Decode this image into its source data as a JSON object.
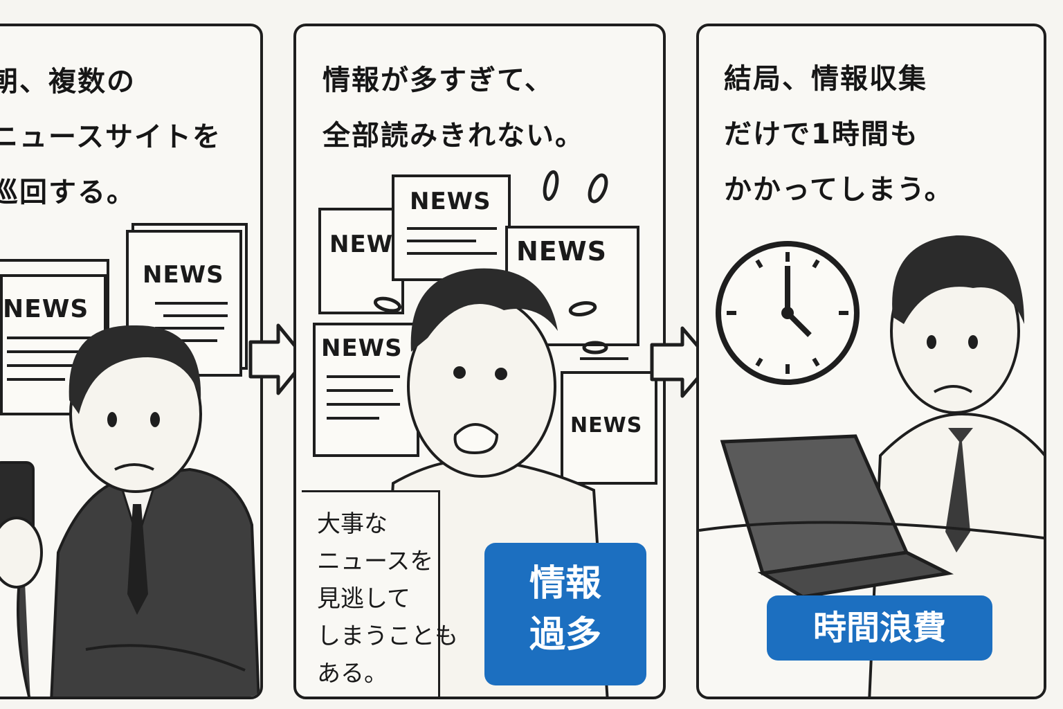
{
  "panels": [
    {
      "caption": "朝、複数の\nニュースサイトを\n巡回する。",
      "news_labels": [
        "NEWS",
        "NEWS"
      ]
    },
    {
      "caption": "情報が多すぎて、\n全部読みきれない。",
      "news_labels": [
        "NEW",
        "NEWS",
        "NEWS",
        "NEWS",
        "NEWS"
      ],
      "note": "大事な\nニュースを\n見逃して\nしまうことも\nある。",
      "badge": "情報\n過多"
    },
    {
      "caption": "結局、情報収集\nだけで1時間も\nかかってしまう。",
      "badge": "時間浪費"
    }
  ],
  "colors": {
    "badge": "#1c6fc0",
    "ink": "#1e1e1e",
    "paper": "#f9f8f4"
  },
  "icons": [
    "right-arrow-icon",
    "clock-icon",
    "smartphone-icon",
    "laptop-icon",
    "sweat-drops-icon"
  ]
}
